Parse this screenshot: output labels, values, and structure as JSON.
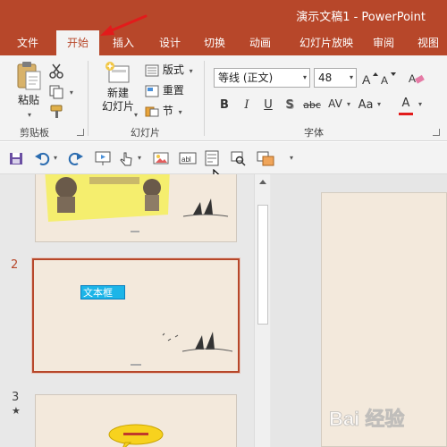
{
  "window": {
    "title": "演示文稿1  -  PowerPoint"
  },
  "tabs": [
    {
      "label": "文件"
    },
    {
      "label": "开始"
    },
    {
      "label": "插入"
    },
    {
      "label": "设计"
    },
    {
      "label": "切换"
    },
    {
      "label": "动画"
    },
    {
      "label": "幻灯片放映"
    },
    {
      "label": "审阅"
    },
    {
      "label": "视图"
    }
  ],
  "active_tab": "开始",
  "ribbon": {
    "clipboard": {
      "paste_label": "粘贴",
      "group_label": "剪贴板"
    },
    "slides": {
      "new_slide_line1": "新建",
      "new_slide_line2": "幻灯片",
      "layout_label": "版式",
      "reset_label": "重置",
      "section_label": "节",
      "group_label": "幻灯片"
    },
    "font": {
      "font_name": "等线 (正文)",
      "font_size": "48",
      "bold": "B",
      "italic": "I",
      "underline": "U",
      "shadow": "S",
      "strikethrough": "abc",
      "spacing": "AV",
      "change_case": "Aa",
      "font_color": "A",
      "group_label": "字体"
    }
  },
  "slides": [
    {
      "number": "",
      "star": ""
    },
    {
      "number": "2",
      "star": "",
      "textbox_text": "文本框"
    },
    {
      "number": "3",
      "star": "★"
    }
  ],
  "colors": {
    "accent": "#b7472a",
    "ribbon_bg": "#f3f3f3",
    "slide_bg": "#f3e9dc",
    "textbox_fill": "#1cb5e8",
    "callout_fill": "#f7d21e"
  },
  "watermark": {
    "text": "Bai 经验"
  }
}
